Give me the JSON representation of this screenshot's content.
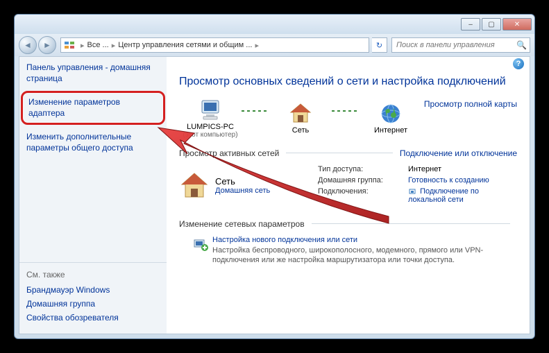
{
  "titlebar": {
    "minimize": "–",
    "maximize": "▢",
    "close": "✕"
  },
  "navbar": {
    "back": "◄",
    "forward": "►",
    "breadcrumb": {
      "seg1": "Все ...",
      "seg2": "Центр управления сетями и общим ..."
    },
    "refresh": "↻",
    "search_placeholder": "Поиск в панели управления"
  },
  "help_tooltip": "?",
  "sidebar": {
    "home": "Панель управления - домашняя страница",
    "adapter_settings": "Изменение параметров адаптера",
    "advanced_sharing": "Изменить дополнительные параметры общего доступа",
    "see_also_title": "См. также",
    "firewall": "Брандмауэр Windows",
    "homegroup": "Домашняя группа",
    "internet_options": "Свойства обозревателя"
  },
  "main": {
    "title": "Просмотр основных сведений о сети и настройка подключений",
    "full_map": "Просмотр полной карты",
    "map_nodes": {
      "computer": "LUMPICS-PC",
      "computer_sub": "(этот компьютер)",
      "network": "Сеть",
      "internet": "Интернет"
    },
    "active_section_label": "Просмотр активных сетей",
    "active_section_link": "Подключение или отключение",
    "active_network": {
      "name": "Сеть",
      "type": "Домашняя сеть",
      "access_type_label": "Тип доступа:",
      "access_type_value": "Интернет",
      "homegroup_label": "Домашняя группа:",
      "homegroup_value": "Готовность к созданию",
      "connections_label": "Подключения:",
      "connections_value": "Подключение по локальной сети"
    },
    "settings_label": "Изменение сетевых параметров",
    "new_connection": {
      "title": "Настройка нового подключения или сети",
      "desc": "Настройка беспроводного, широкополосного, модемного, прямого или VPN-подключения или же настройка маршрутизатора или точки доступа."
    }
  }
}
